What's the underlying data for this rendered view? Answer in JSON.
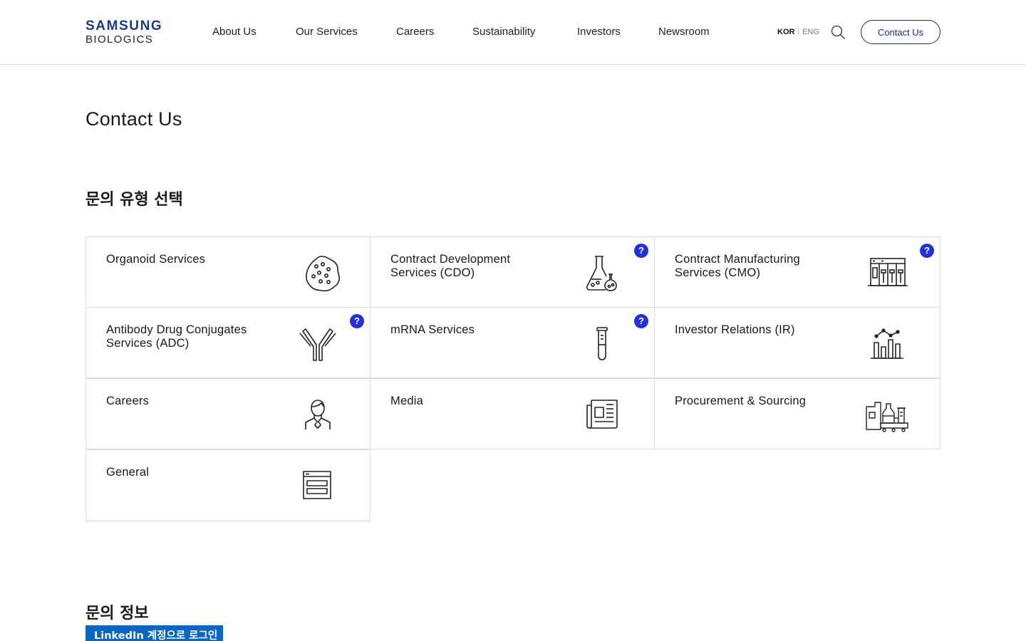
{
  "header": {
    "logo_top": "SAMSUNG",
    "logo_bottom": "BIOLOGICS",
    "nav": [
      "About Us",
      "Our Services",
      "Careers",
      "Sustainability",
      "Investors",
      "Newsroom"
    ],
    "lang_kor": "KOR",
    "lang_sep": "|",
    "lang_eng": "ENG",
    "search_icon": "search-icon",
    "contact_label": "Contact Us",
    "accent_color": "#1f2a8c"
  },
  "main": {
    "title": "Contact Us",
    "section_inquiry_type": "문의 유형 선택",
    "section_inquiry_info": "문의 정보",
    "linkedin_label": "LinkedIn 계정으로 로그인",
    "help_mark": "?",
    "cards": [
      {
        "label": "Organoid Services",
        "icon": "organoid-icon",
        "help": false
      },
      {
        "label": "Contract Development Services (CDO)",
        "icon": "flask-icon",
        "help": true
      },
      {
        "label": "Contract Manufacturing Services (CMO)",
        "icon": "factory-equipment-icon",
        "help": true
      },
      {
        "label": "Antibody Drug Conjugates Services (ADC)",
        "icon": "antibody-icon",
        "help": true
      },
      {
        "label": "mRNA Services",
        "icon": "test-tube-icon",
        "help": true
      },
      {
        "label": "Investor Relations (IR)",
        "icon": "bar-chart-icon",
        "help": false
      },
      {
        "label": "Careers",
        "icon": "person-icon",
        "help": false
      },
      {
        "label": "Media",
        "icon": "newspaper-icon",
        "help": false
      },
      {
        "label": "Procurement & Sourcing",
        "icon": "supply-equipment-icon",
        "help": false
      },
      {
        "label": "General",
        "icon": "browser-window-icon",
        "help": false
      }
    ]
  }
}
